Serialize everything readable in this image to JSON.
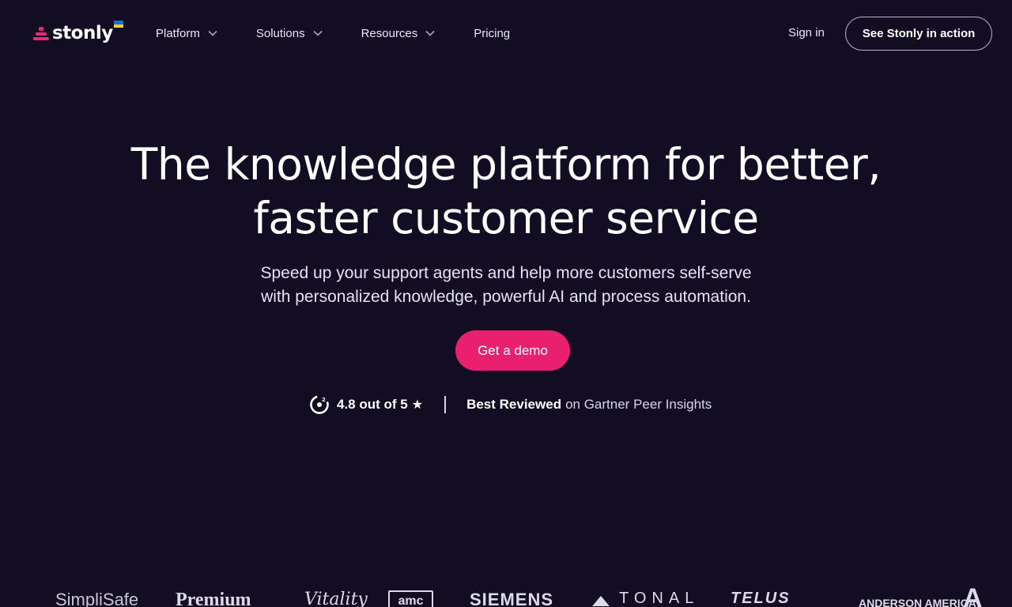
{
  "brand": {
    "name": "stonly",
    "accent_color": "#e8206f",
    "background_color": "#130d24"
  },
  "nav": {
    "items": [
      {
        "label": "Platform",
        "has_dropdown": true
      },
      {
        "label": "Solutions",
        "has_dropdown": true
      },
      {
        "label": "Resources",
        "has_dropdown": true
      },
      {
        "label": "Pricing",
        "has_dropdown": false
      }
    ],
    "sign_in": "Sign in",
    "cta": "See Stonly in action"
  },
  "hero": {
    "title_line1": "The knowledge platform for better,",
    "title_line2": "faster customer service",
    "subtitle_line1": "Speed up your support agents and help more customers self-serve",
    "subtitle_line2": "with personalized knowledge, powerful AI and process automation.",
    "cta": "Get a demo"
  },
  "rating": {
    "score_text": "4.8 out of 5",
    "star": "★",
    "reviewed_bold": "Best Reviewed",
    "reviewed_rest": "on Gartner Peer Insights"
  },
  "customer_logos": [
    "SimpliSafe",
    "Premium",
    "Vitality",
    "amc",
    "SIEMENS",
    "TONAL",
    "TELUS",
    "ANDERSON AMERICA",
    "A"
  ],
  "icons": [
    "stonly-logo-icon",
    "ukraine-flag-icon",
    "chevron-down-icon",
    "g2-icon",
    "star-icon"
  ]
}
